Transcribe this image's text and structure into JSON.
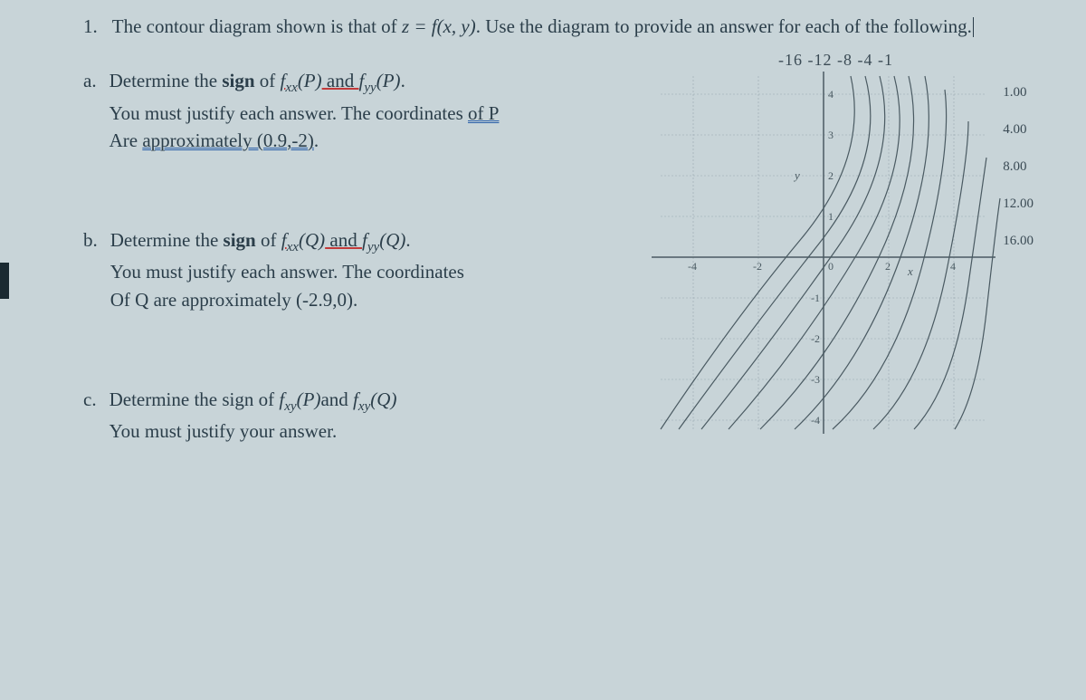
{
  "problem": {
    "number": "1.",
    "intro_prefix": "The contour diagram shown is that of ",
    "intro_equation": "z = f(x, y)",
    "intro_suffix": ". Use the diagram to provide an answer for each of the following."
  },
  "parts": {
    "a": {
      "label": "a.",
      "line1_prefix": "Determine the ",
      "line1_sign": "sign",
      "line1_mid1": " of ",
      "line1_f1": "f",
      "line1_sub1": "xx",
      "line1_p1": "(P)",
      "line1_and": " and ",
      "line1_f2": "f",
      "line1_sub2": "yy",
      "line1_p2": "(P)",
      "line1_end": ".",
      "line2_prefix": "You must justify each answer. The coordinates ",
      "line2_ofp": "of P",
      "line3_prefix": "Are ",
      "line3_approx": "approximately  (0.9,-2)",
      "line3_end": "."
    },
    "b": {
      "label": "b.",
      "line1_prefix": "Determine the ",
      "line1_sign": "sign",
      "line1_mid1": " of ",
      "line1_f1": "f",
      "line1_sub1": "xx",
      "line1_q1": "(Q)",
      "line1_and": " and ",
      "line1_f2": "f",
      "line1_sub2": "yy",
      "line1_q2": "(Q)",
      "line1_end": ".",
      "line2": "You must justify each answer. The coordinates",
      "line3": "Of Q are approximately (-2.9,0)."
    },
    "c": {
      "label": "c.",
      "line1_prefix": "Determine the sign of ",
      "line1_f1": "f",
      "line1_sub1": "xy",
      "line1_p": "(P)",
      "line1_and": "and ",
      "line1_f2": "f",
      "line1_sub2": "xy",
      "line1_q": "(Q)",
      "line2": "You must justify your answer."
    }
  },
  "contour": {
    "top_labels": "-16  -12  -8  -4   -1",
    "right_labels": [
      "1.00",
      "4.00",
      "8.00",
      "12.00",
      "16.00"
    ],
    "x_ticks": [
      "-4",
      "-2",
      "0",
      "2",
      "4"
    ],
    "y_ticks": [
      "4",
      "3",
      "2",
      "1",
      "-1",
      "-2",
      "-3",
      "-4"
    ],
    "x_axis_label": "x",
    "y_axis_label": "y"
  },
  "chart_data": {
    "type": "contour",
    "title": "Contour diagram of z = f(x,y)",
    "xlabel": "x",
    "ylabel": "y",
    "xlim": [
      -5,
      5
    ],
    "ylim": [
      -4,
      4
    ],
    "contour_levels": [
      -16,
      -12,
      -8,
      -4,
      -1,
      1,
      4,
      8,
      12,
      16
    ],
    "description": "Diagonal contour lines running roughly lower-left to upper-right. Negative levels (−16 to −1) cluster toward the upper-left and enter along the top edge; positive levels (1 to 16) exit along the right edge. Lines become more closely spaced toward the upper-left (steeper) and more widely spaced toward the lower-right (flatter).",
    "points_of_interest": {
      "P": {
        "x": 0.9,
        "y": -2
      },
      "Q": {
        "x": -2.9,
        "y": 0
      }
    }
  }
}
